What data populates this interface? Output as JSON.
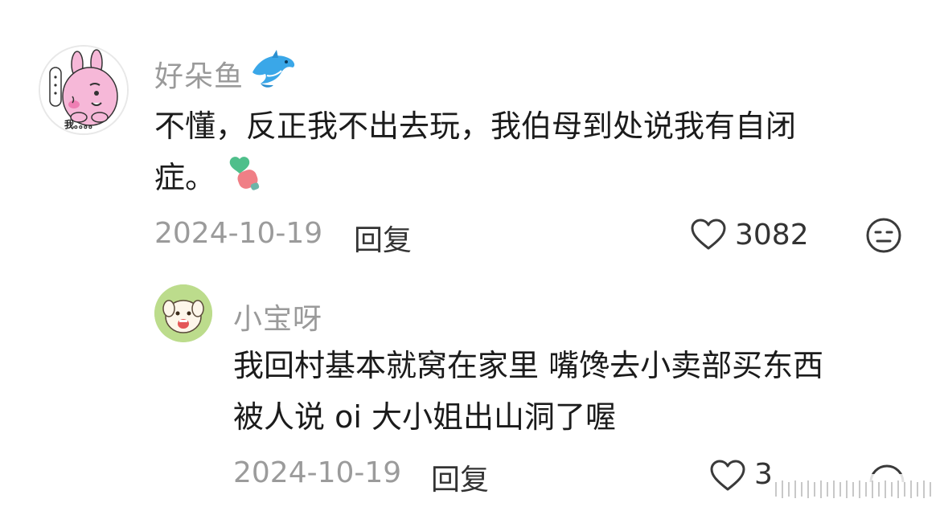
{
  "comments": [
    {
      "author": "好朵鱼",
      "author_emoji": "dolphin-icon",
      "avatar_caption": "我。。。。",
      "text_line1": "不懂，反正我不出去玩，我伯母到处说我有自闭",
      "text_line2": "症。",
      "text_emoji": "carrot-heart-sticker-icon",
      "date": "2024-10-19",
      "reply_label": "回复",
      "likes": "3082",
      "dislike_icon": "neutral-face-icon"
    },
    {
      "author": "小宝呀",
      "text_line1": "我回村基本就窝在家里 嘴馋去小卖部买东西",
      "text_line2": "被人说 oi 大小姐出山洞了喔",
      "date": "2024-10-19",
      "reply_label": "回复",
      "likes": "3"
    }
  ],
  "colors": {
    "name": "#9a9a9a",
    "text": "#1b1b1b",
    "meta": "#9b9b9b",
    "avatar_ring": "#e6e6e6"
  }
}
